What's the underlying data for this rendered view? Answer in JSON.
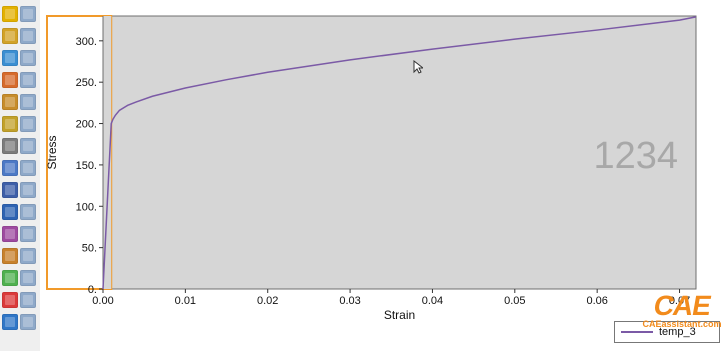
{
  "toolbar": {
    "items": [
      {
        "icon": "numbered-grid-icon",
        "color": "#e3b100"
      },
      {
        "icon": "table-icon",
        "color": "#d2a227"
      },
      {
        "icon": "plot-xy-icon",
        "color": "#3b8fd2"
      },
      {
        "icon": "stack-icon",
        "color": "#d66b2c"
      },
      {
        "icon": "layers-icon",
        "color": "#c78d2b"
      },
      {
        "icon": "curve-options-icon",
        "color": "#c2a12b"
      },
      {
        "icon": "grid-settings-icon",
        "color": "#7c7c7c"
      },
      {
        "icon": "dots-matrix-icon",
        "color": "#4c79c6"
      },
      {
        "icon": "node-tree-icon",
        "color": "#3d5ea8"
      },
      {
        "icon": "spreadsheet-icon",
        "color": "#2e63b2"
      },
      {
        "icon": "path-icon",
        "color": "#9e4aa0"
      },
      {
        "icon": "probe-icon",
        "color": "#c7812c"
      },
      {
        "icon": "mesh-icon",
        "color": "#4fb04f"
      },
      {
        "icon": "color-map-icon",
        "color": "#db3a3a"
      },
      {
        "icon": "export-icon",
        "color": "#2f76c7"
      }
    ]
  },
  "chart_data": {
    "type": "line",
    "xlabel": "Strain",
    "ylabel": "Stress",
    "xlim": [
      0,
      0.072
    ],
    "ylim": [
      0,
      330
    ],
    "xticks": [
      0.0,
      0.01,
      0.02,
      0.03,
      0.04,
      0.05,
      0.06,
      0.07
    ],
    "xtick_labels": [
      "0.00",
      "0.01",
      "0.02",
      "0.03",
      "0.04",
      "0.05",
      "0.06",
      "0.07"
    ],
    "yticks": [
      0,
      50,
      100,
      150,
      200,
      250,
      300
    ],
    "ytick_labels": [
      "0.",
      "50.",
      "100.",
      "150.",
      "200.",
      "250.",
      "300."
    ],
    "background_color": "#d6d6d6",
    "line_color": "#7b5aa6",
    "highlight_color": "#f19a2a",
    "series": [
      {
        "name": "temp_3",
        "x": [
          0,
          0.0003,
          0.0006,
          0.0009,
          0.001,
          0.0012,
          0.0015,
          0.002,
          0.003,
          0.004,
          0.006,
          0.008,
          0.01,
          0.015,
          0.02,
          0.03,
          0.04,
          0.05,
          0.06,
          0.07,
          0.072
        ],
        "y": [
          0,
          60,
          120,
          180,
          200,
          205,
          210,
          216,
          222,
          226,
          233,
          238,
          243,
          253,
          262,
          277,
          290,
          302,
          313,
          325,
          329
        ]
      }
    ],
    "watermark": "1234",
    "legend": {
      "position": "bottom-right",
      "label": "temp_3"
    }
  },
  "brand": {
    "mark": "CAE",
    "name": "CAEassistant.com"
  }
}
